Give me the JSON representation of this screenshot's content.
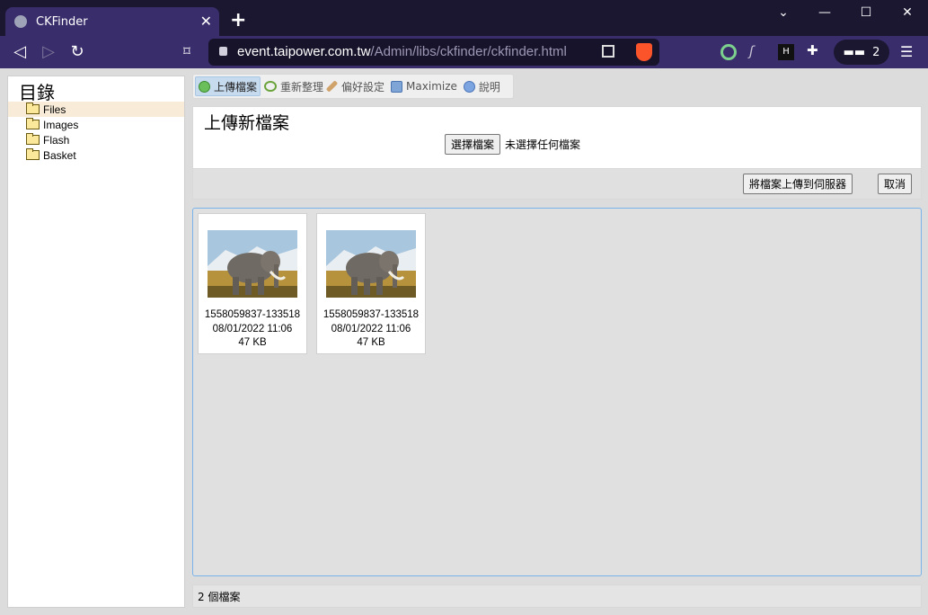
{
  "browser": {
    "tab_title": "CKFinder",
    "tab_close": "✕",
    "new_tab": "+",
    "url_host": "event.taipower.com.tw",
    "url_path": "/Admin/libs/ckfinder/ckfinder.html",
    "profile_count": "2"
  },
  "sidebar": {
    "title": "目錄",
    "folders": [
      "Files",
      "Images",
      "Flash",
      "Basket"
    ]
  },
  "toolbar": {
    "upload": "上傳檔案",
    "refresh": "重新整理",
    "settings": "偏好設定",
    "maximize": "Maximize",
    "help": "說明"
  },
  "upload_panel": {
    "title": "上傳新檔案",
    "choose_button": "選擇檔案",
    "no_file": "未選擇任何檔案",
    "upload_button": "將檔案上傳到伺服器",
    "cancel_button": "取消"
  },
  "files": [
    {
      "name": "1558059837-133518",
      "date": "08/01/2022 11:06",
      "size": "47 KB"
    },
    {
      "name": "1558059837-133518",
      "date": "08/01/2022 11:06",
      "size": "47 KB"
    }
  ],
  "status": "2 個檔案",
  "colors": {
    "chrome_dark": "#1b1731",
    "chrome_toolbar": "#3a2d6b",
    "selection": "#f8ecd9",
    "focus_border": "#7ab3ea"
  }
}
